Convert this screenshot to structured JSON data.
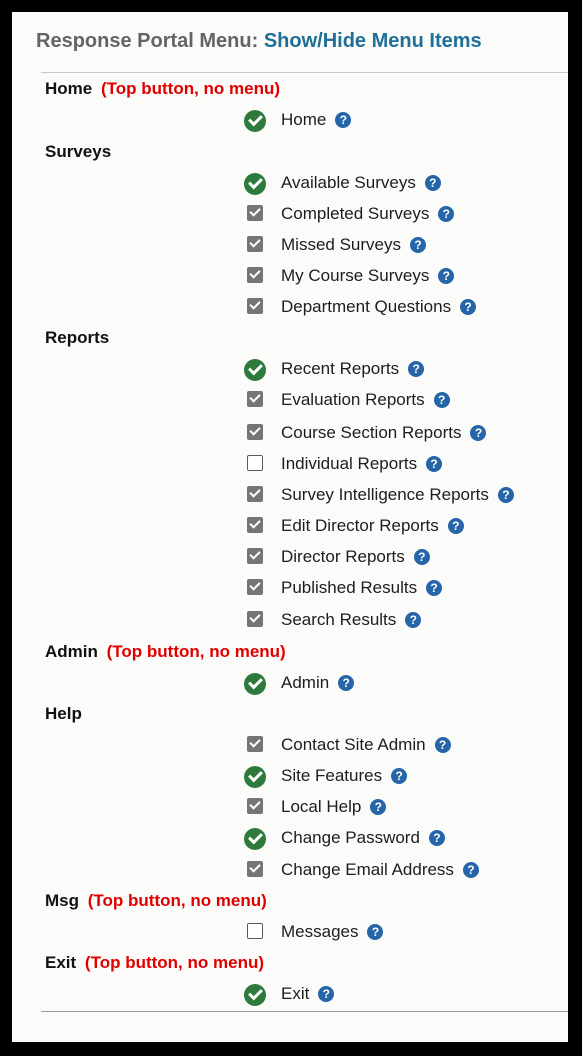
{
  "header": {
    "title": "Response Portal Menu:",
    "link": "Show/Hide Menu Items"
  },
  "help_glyph": "?",
  "sections": {
    "home": {
      "label": "Home",
      "note": "(Top button, no menu)"
    },
    "surveys": {
      "label": "Surveys"
    },
    "reports": {
      "label": "Reports"
    },
    "admin": {
      "label": "Admin",
      "note": "(Top button, no menu)"
    },
    "help": {
      "label": "Help"
    },
    "msg": {
      "label": "Msg",
      "note": "(Top button, no menu)"
    },
    "exit": {
      "label": "Exit",
      "note": "(Top button, no menu)"
    }
  },
  "items": {
    "home": {
      "label": "Home",
      "state": "required"
    },
    "available_surveys": {
      "label": "Available Surveys",
      "state": "required"
    },
    "completed_surveys": {
      "label": "Completed Surveys",
      "state": "checked"
    },
    "missed_surveys": {
      "label": "Missed Surveys",
      "state": "checked"
    },
    "my_course_surveys": {
      "label": "My Course Surveys",
      "state": "checked"
    },
    "department_questions": {
      "label": "Department Questions",
      "state": "checked"
    },
    "recent_reports": {
      "label": "Recent Reports",
      "state": "required"
    },
    "evaluation_reports": {
      "label": "Evaluation Reports",
      "state": "checked"
    },
    "course_section_reports": {
      "label": "Course Section Reports",
      "state": "checked"
    },
    "individual_reports": {
      "label": "Individual Reports",
      "state": "unchecked"
    },
    "survey_intelligence_reports": {
      "label": "Survey Intelligence Reports",
      "state": "checked"
    },
    "edit_director_reports": {
      "label": "Edit Director Reports",
      "state": "checked"
    },
    "director_reports": {
      "label": "Director Reports",
      "state": "checked"
    },
    "published_results": {
      "label": "Published Results",
      "state": "checked"
    },
    "search_results": {
      "label": "Search Results",
      "state": "checked"
    },
    "admin": {
      "label": "Admin",
      "state": "required"
    },
    "contact_site_admin": {
      "label": "Contact Site Admin",
      "state": "checked"
    },
    "site_features": {
      "label": "Site Features",
      "state": "required"
    },
    "local_help": {
      "label": "Local Help",
      "state": "checked"
    },
    "change_password": {
      "label": "Change Password",
      "state": "required"
    },
    "change_email_address": {
      "label": "Change Email Address",
      "state": "checked"
    },
    "messages": {
      "label": "Messages",
      "state": "unchecked"
    },
    "exit": {
      "label": "Exit",
      "state": "required"
    }
  },
  "colors": {
    "required_check": "#2d7a3c",
    "checkbox_checked": "#757575",
    "help_icon": "#2565a8",
    "note_text": "#e00000",
    "link_text": "#1f6f99"
  }
}
